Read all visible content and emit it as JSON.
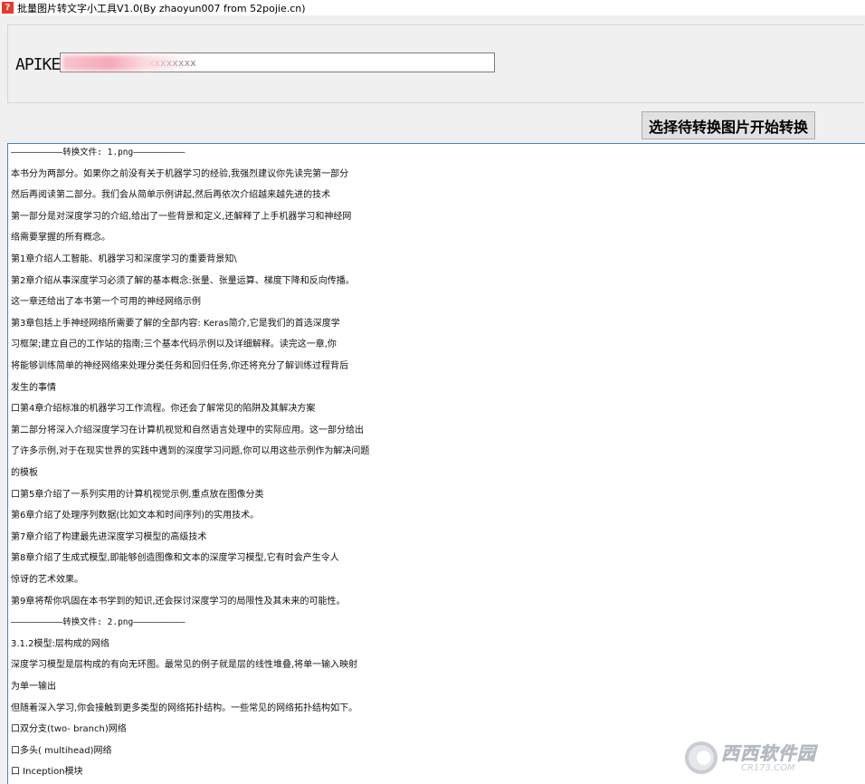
{
  "window": {
    "title": "批量图片转文字小工具V1.0(By zhaoyun007 from 52pojie.cn)",
    "icon": "question-app-icon",
    "icon_glyph": "?",
    "icon_color": "#e8392a"
  },
  "settings": {
    "apikey_label": "APIKEY",
    "apikey_value": "LWGH8Yxx  xxxxxxxxxxxx"
  },
  "toolbar": {
    "convert_label": "选择待转换图片开始转换"
  },
  "output": {
    "lines": [
      {
        "text": "——————————转换文件: 1.png——————————",
        "mono": true
      },
      {
        "text": "本书分为两部分。如果你之前没有关于机器学习的经验,我强烈建议你先读完第一部分",
        "mono": false
      },
      {
        "text": "然后再阅读第二部分。我们会从简单示例讲起,然后再依次介绍越来越先进的技术",
        "mono": false
      },
      {
        "text": "第一部分是对深度学习的介绍,给出了一些背景和定义,还解释了上手机器学习和神经网",
        "mono": false
      },
      {
        "text": "络需要掌握的所有概念。",
        "mono": false
      },
      {
        "text": "第1章介绍人工智能、机器学习和深度学习的重要背景知\\",
        "mono": false
      },
      {
        "text": "第2章介绍从事深度学习必须了解的基本概念:张量、张量运算、梯度下降和反向传播。",
        "mono": false
      },
      {
        "text": "这一章还给出了本书第一个可用的神经网络示例",
        "mono": false
      },
      {
        "text": "第3章包括上手神经网络所需要了解的全部内容: Keras简介,它是我们的首选深度学",
        "mono": false
      },
      {
        "text": "习框架;建立自己的工作站的指南;三个基本代码示例以及详细解释。读完这一章,你",
        "mono": false
      },
      {
        "text": "将能够训练简单的神经网络来处理分类任务和回归任务,你还将充分了解训练过程背后",
        "mono": false
      },
      {
        "text": "发生的事情",
        "mono": false
      },
      {
        "text": "口第4章介绍标准的机器学习工作流程。你还会了解常见的陷阱及其解决方案",
        "mono": false
      },
      {
        "text": "第二部分将深入介绍深度学习在计算机视觉和自然语言处理中的实际应用。这一部分给出",
        "mono": false
      },
      {
        "text": "了许多示例,对于在现实世界的实践中遇到的深度学习问题,你可以用这些示例作为解决问题",
        "mono": false
      },
      {
        "text": "的模板",
        "mono": false
      },
      {
        "text": "口第5章介绍了一系列实用的计算机视觉示例,重点放在图像分类",
        "mono": false
      },
      {
        "text": "第6章介绍了处理序列数据(比如文本和时间序列)的实用技术。",
        "mono": false
      },
      {
        "text": "第7章介绍了构建最先进深度学习模型的高级技术",
        "mono": false
      },
      {
        "text": "第8章介绍了生成式模型,即能够创造图像和文本的深度学习模型,它有时会产生令人",
        "mono": false
      },
      {
        "text": "惊讶的艺术效果。",
        "mono": false
      },
      {
        "text": "第9章将帮你巩固在本书学到的知识,还会探讨深度学习的局限性及其未来的可能性。",
        "mono": false
      },
      {
        "text": "——————————转换文件: 2.png——————————",
        "mono": true
      },
      {
        "text": "3.1.2模型:层构成的网络",
        "mono": false
      },
      {
        "text": "深度学习模型是层构成的有向无环图。最常见的例子就是层的线性堆叠,将单一输入映射",
        "mono": false
      },
      {
        "text": "为单一输出",
        "mono": false
      },
      {
        "text": "但随着深入学习,你会接触到更多类型的网络拓扑结构。一些常见的网络拓扑结构如下。",
        "mono": false
      },
      {
        "text": "口双分支(two- branch)网络",
        "mono": false
      },
      {
        "text": "口多头( multihead)网络",
        "mono": false
      },
      {
        "text": "口 Inception模块",
        "mono": false
      }
    ]
  },
  "watermark": {
    "brand": "西西软件园",
    "url": "CR173.COM"
  }
}
